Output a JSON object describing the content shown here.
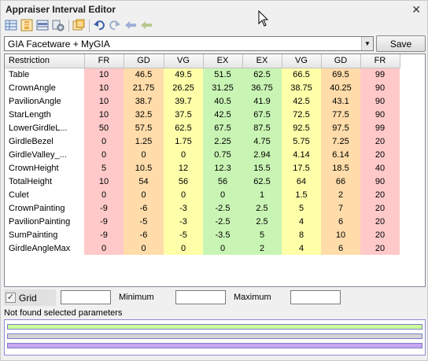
{
  "window": {
    "title": "Appraiser Interval Editor",
    "close_glyph": "✕"
  },
  "toolbar": {
    "icons": [
      "grid-view-icon",
      "columns-icon",
      "rows-icon",
      "settings-icon",
      "export-icon",
      "undo-icon",
      "redo-icon",
      "back-arrow-icon",
      "forward-arrow-icon"
    ]
  },
  "combo": {
    "value": "GIA Facetware + MyGIA",
    "arrow": "▼"
  },
  "save_label": "Save",
  "table": {
    "columns": [
      "Restriction",
      "FR",
      "GD",
      "VG",
      "EX",
      "EX",
      "VG",
      "GD",
      "FR"
    ],
    "column_colors": [
      "#ffc9c9",
      "#ffdcaa",
      "#ffffaa",
      "#c9f5b4",
      "#c9f5b4",
      "#ffffaa",
      "#ffdcaa",
      "#ffc9c9"
    ],
    "rows": [
      [
        "Table",
        "10",
        "46.5",
        "49.5",
        "51.5",
        "62.5",
        "66.5",
        "69.5",
        "99"
      ],
      [
        "CrownAngle",
        "10",
        "21.75",
        "26.25",
        "31.25",
        "36.75",
        "38.75",
        "40.25",
        "90"
      ],
      [
        "PavilionAngle",
        "10",
        "38.7",
        "39.7",
        "40.5",
        "41.9",
        "42.5",
        "43.1",
        "90"
      ],
      [
        "StarLength",
        "10",
        "32.5",
        "37.5",
        "42.5",
        "67.5",
        "72.5",
        "77.5",
        "90"
      ],
      [
        "LowerGirdleL...",
        "50",
        "57.5",
        "62.5",
        "67.5",
        "87.5",
        "92.5",
        "97.5",
        "99"
      ],
      [
        "GirdleBezel",
        "0",
        "1.25",
        "1.75",
        "2.25",
        "4.75",
        "5.75",
        "7.25",
        "20"
      ],
      [
        "GirdleValley_...",
        "0",
        "0",
        "0",
        "0.75",
        "2.94",
        "4.14",
        "6.14",
        "20"
      ],
      [
        "CrownHeight",
        "5",
        "10.5",
        "12",
        "12.3",
        "15.5",
        "17.5",
        "18.5",
        "40"
      ],
      [
        "TotalHeight",
        "10",
        "54",
        "56",
        "56",
        "62.5",
        "64",
        "66",
        "90"
      ],
      [
        "Culet",
        "0",
        "0",
        "0",
        "0",
        "1",
        "1.5",
        "2",
        "20"
      ],
      [
        "CrownPainting",
        "-9",
        "-6",
        "-3",
        "-2.5",
        "2.5",
        "5",
        "7",
        "20"
      ],
      [
        "PavilionPainting",
        "-9",
        "-5",
        "-3",
        "-2.5",
        "2.5",
        "4",
        "6",
        "20"
      ],
      [
        "SumPainting",
        "-9",
        "-6",
        "-5",
        "-3.5",
        "5",
        "8",
        "10",
        "20"
      ],
      [
        "GirdleAngleMax",
        "0",
        "0",
        "0",
        "0",
        "2",
        "4",
        "6",
        "20"
      ]
    ]
  },
  "filters": {
    "grid_label": "Grid",
    "grid_checked_glyph": "✓",
    "minimum_label": "Minimum",
    "maximum_label": "Maximum",
    "grid_value": "",
    "minimum_value": "",
    "maximum_value": ""
  },
  "status": "Not found selected parameters",
  "bars": [
    {
      "color": "#ccff99"
    },
    {
      "color": "#d4d4d4"
    },
    {
      "color": "#c8a8f0"
    }
  ]
}
